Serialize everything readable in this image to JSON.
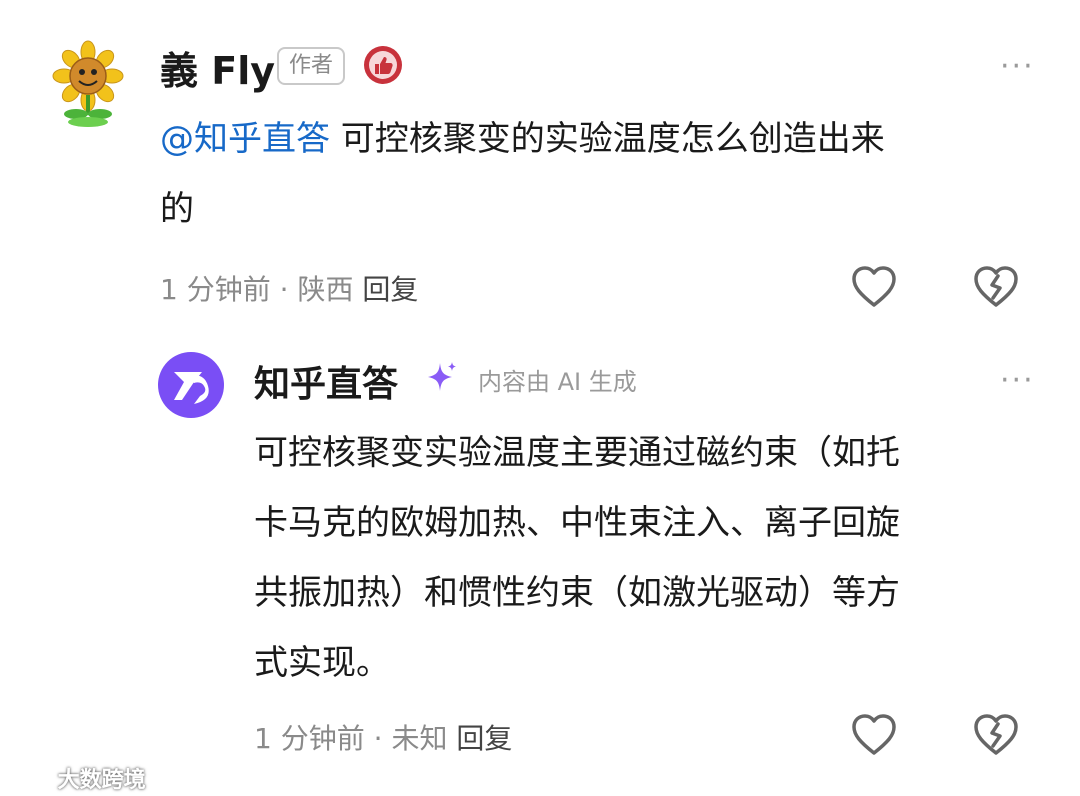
{
  "comment": {
    "author": "義 Fly",
    "author_badge": "作者",
    "mention": "@知乎直答",
    "text_line1": " 可控核聚变的实验温度怎么创造出来",
    "text_line2": "的",
    "time": "1 分钟前",
    "separator": "·",
    "location": "陕西",
    "reply": "回复",
    "more": "···"
  },
  "reply": {
    "author": "知乎直答",
    "ai_note": "内容由 AI 生成",
    "lines": [
      "可控核聚变实验温度主要通过磁约束（如托",
      "卡马克的欧姆加热、中性束注入、离子回旋",
      "共振加热）和惯性约束（如激光驱动）等方",
      "式实现。"
    ],
    "time": "1 分钟前",
    "separator": "·",
    "location": "未知",
    "reply": "回复",
    "more": "···"
  },
  "watermark": "大数跨境",
  "colors": {
    "mention": "#1769c8",
    "ai_avatar": "#7a4ef5",
    "sparkle": "#8a5cf6",
    "like_badge": "#c8323c"
  },
  "icons": [
    "sunflower-avatar",
    "ai-avatar",
    "like-badge-icon",
    "sparkle-icon",
    "heart-icon",
    "dislike-icon",
    "more-icon"
  ]
}
